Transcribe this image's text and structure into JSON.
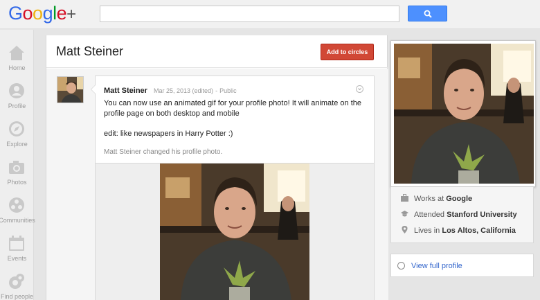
{
  "search": {
    "placeholder": ""
  },
  "nav": [
    {
      "label": "Home",
      "icon": "home-icon"
    },
    {
      "label": "Profile",
      "icon": "profile-icon"
    },
    {
      "label": "Explore",
      "icon": "explore-icon"
    },
    {
      "label": "Photos",
      "icon": "photos-icon"
    },
    {
      "label": "Communities",
      "icon": "communities-icon"
    },
    {
      "label": "Events",
      "icon": "events-icon"
    },
    {
      "label": "Find people",
      "icon": "find-people-icon"
    }
  ],
  "header": {
    "name": "Matt Steiner",
    "add_button": "Add to circles"
  },
  "post": {
    "author": "Matt Steiner",
    "date": "Mar 25, 2013 (edited)",
    "dot": "-",
    "visibility": "Public",
    "text": "You can now use an animated gif for your profile photo!  It will animate on the profile page on both desktop and mobile",
    "edit": "edit:  like newspapers in Harry Potter :)",
    "activity": "Matt Steiner changed his profile photo."
  },
  "about": {
    "work_prefix": "Works at",
    "work": "Google",
    "edu_prefix": "Attended",
    "edu": "Stanford University",
    "loc_prefix": "Lives in",
    "loc": "Los Altos, California"
  },
  "view_profile": "View full profile",
  "colors": {
    "accent_blue": "#4d90fe",
    "add_red": "#d14836",
    "link": "#3366cc"
  }
}
